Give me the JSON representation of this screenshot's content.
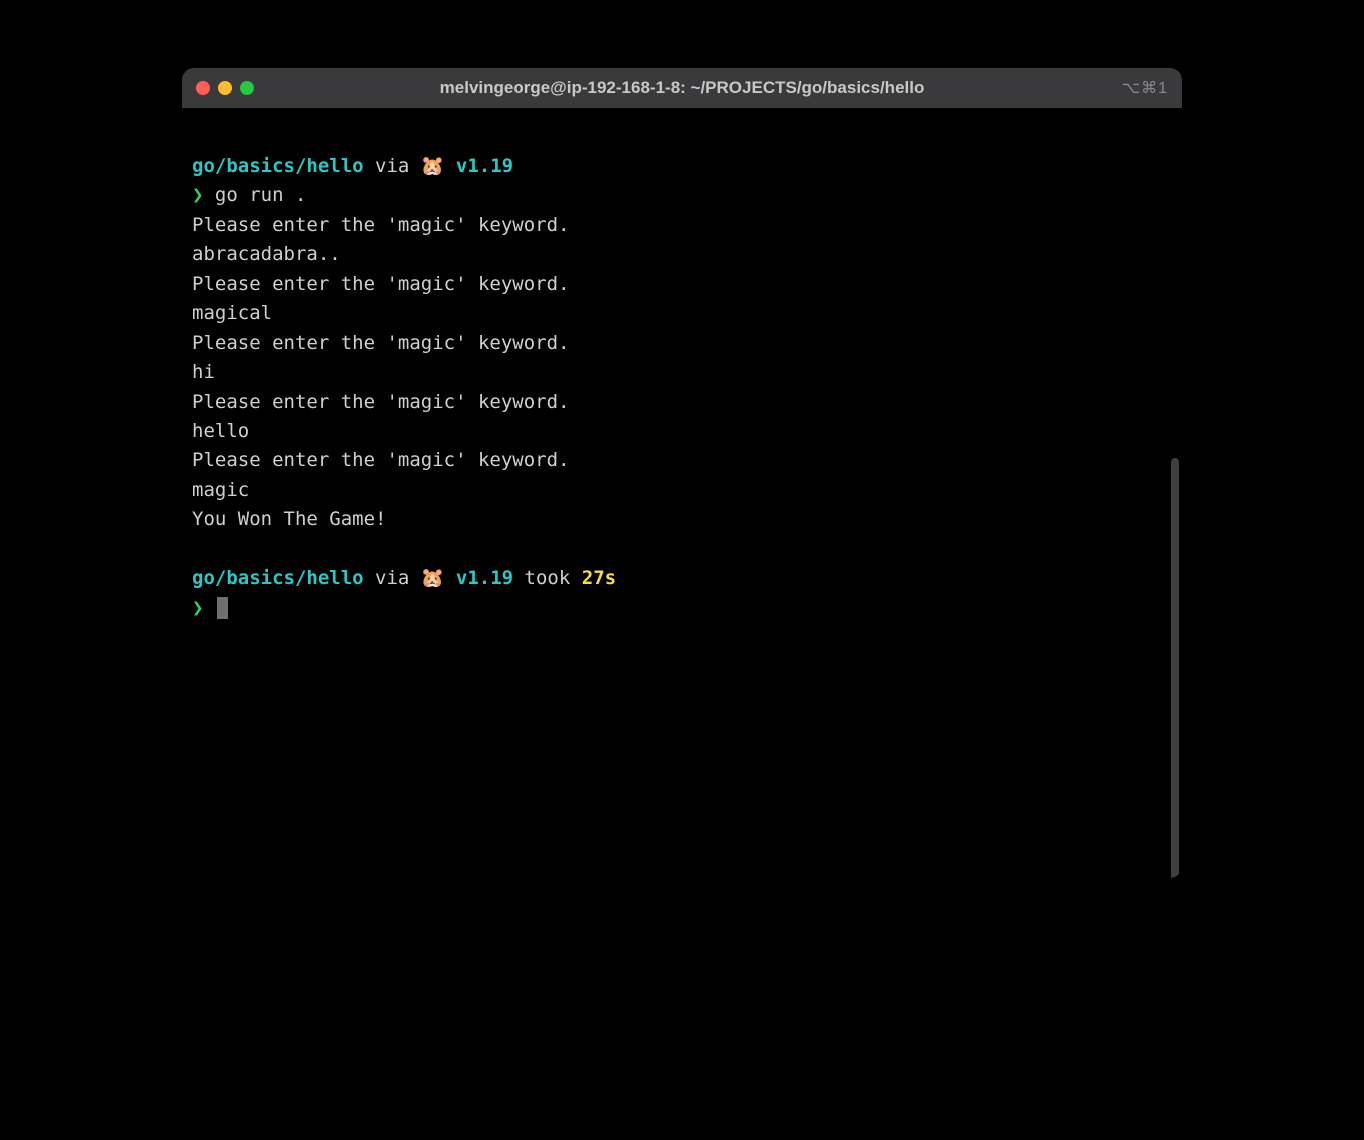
{
  "titlebar": {
    "title": "melvingeorge@ip-192-168-1-8: ~/PROJECTS/go/basics/hello",
    "shortcut": "⌥⌘1"
  },
  "prompt1": {
    "path": "go/basics/hello",
    "via": " via ",
    "emoji": "🐹",
    "version": " v1.19"
  },
  "command": {
    "arrow": "❯",
    "text": " go run ."
  },
  "output": [
    "Please enter the 'magic' keyword.",
    "abracadabra..",
    "Please enter the 'magic' keyword.",
    "magical",
    "Please enter the 'magic' keyword.",
    "hi",
    "Please enter the 'magic' keyword.",
    "hello",
    "Please enter the 'magic' keyword.",
    "magic",
    "You Won The Game!"
  ],
  "prompt2": {
    "path": "go/basics/hello",
    "via": " via ",
    "emoji": "🐹",
    "version": " v1.19",
    "took": " took ",
    "duration": "27s"
  },
  "prompt2_arrow": "❯"
}
